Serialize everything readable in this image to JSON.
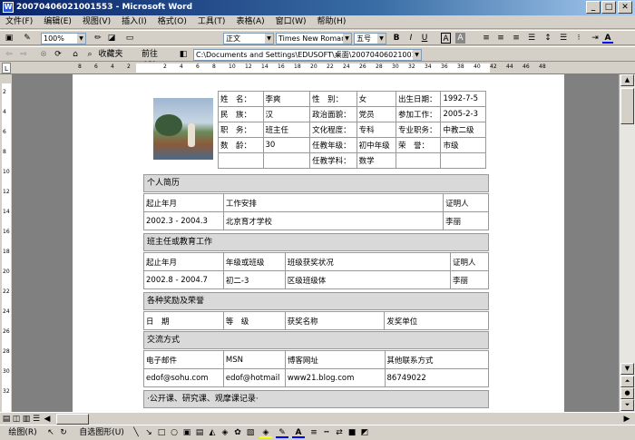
{
  "window": {
    "title": "20070406021001553 - Microsoft Word"
  },
  "menu": [
    "文件(F)",
    "编辑(E)",
    "视图(V)",
    "插入(I)",
    "格式(O)",
    "工具(T)",
    "表格(A)",
    "窗口(W)",
    "帮助(H)"
  ],
  "toolbar": {
    "zoom": "100%",
    "style": "正文",
    "font": "Times New Roman",
    "size": "五号",
    "bold": "B",
    "italic": "I",
    "underline": "U",
    "textA": "A"
  },
  "web": {
    "favorites": "收藏夹",
    "goto": "前往(G)",
    "address": "C:\\Documents and Settings\\EDUSOFT\\桌面\\20070406021001553."
  },
  "ruler": {
    "left_numbers": [
      "8",
      "6",
      "4",
      "2"
    ],
    "right_numbers": [
      "2",
      "4",
      "6",
      "8",
      "10",
      "12",
      "14",
      "16",
      "18",
      "20",
      "22",
      "24",
      "26",
      "28",
      "30",
      "32",
      "34",
      "36",
      "38",
      "40",
      "42",
      "44",
      "46",
      "48"
    ]
  },
  "vruler": [
    "2",
    "4",
    "6",
    "8",
    "10",
    "12",
    "14",
    "16",
    "18",
    "20",
    "22",
    "24",
    "26",
    "28",
    "30",
    "32"
  ],
  "profile": [
    [
      "姓　名：",
      "李爽",
      "性　别：",
      "女",
      "出生日期：",
      "1992-7-5"
    ],
    [
      "民　族：",
      "汉",
      "政治面貌：",
      "党员",
      "参加工作：",
      "2005-2-3"
    ],
    [
      "职　务：",
      "班主任",
      "文化程度：",
      "专科",
      "专业职务：",
      "中教二级"
    ],
    [
      "数　龄：",
      "30",
      "任教年级：",
      "初中年级",
      "荣　誉：",
      "市级"
    ],
    [
      "",
      "",
      "任教学科：",
      "数学",
      "",
      ""
    ]
  ],
  "sections": {
    "resume": "个人简历",
    "teaching": "班主任或教育工作",
    "awards": "各种奖励及荣誉",
    "contact": "交流方式",
    "lessons": "·公开课、研究课、观摩课记录·"
  },
  "resume_table": [
    [
      "起止年月",
      "工作安排",
      "证明人"
    ],
    [
      "2002.3 - 2004.3",
      "北京育才学校",
      "李丽"
    ]
  ],
  "teaching_table": [
    [
      "起止年月",
      "年级或班级",
      "班级获奖状况",
      "证明人"
    ],
    [
      "2002.8 - 2004.7",
      "初二-3",
      "区级班级体",
      "李丽"
    ]
  ],
  "awards_table": [
    [
      "日　期",
      "等　级",
      "获奖名称",
      "发奖单位"
    ]
  ],
  "contact_table": [
    [
      "电子邮件",
      "MSN",
      "博客网址",
      "其他联系方式"
    ],
    [
      "edof@sohu.com",
      "edof@hotmail",
      "www21.blog.com",
      "86749022"
    ]
  ],
  "drawbar": {
    "draw": "绘图(R)",
    "autoshape": "自选图形(U)"
  },
  "colors": {
    "title_start": "#0a246a",
    "title_end": "#a6caf0",
    "section_bg": "#d9d9d9"
  }
}
